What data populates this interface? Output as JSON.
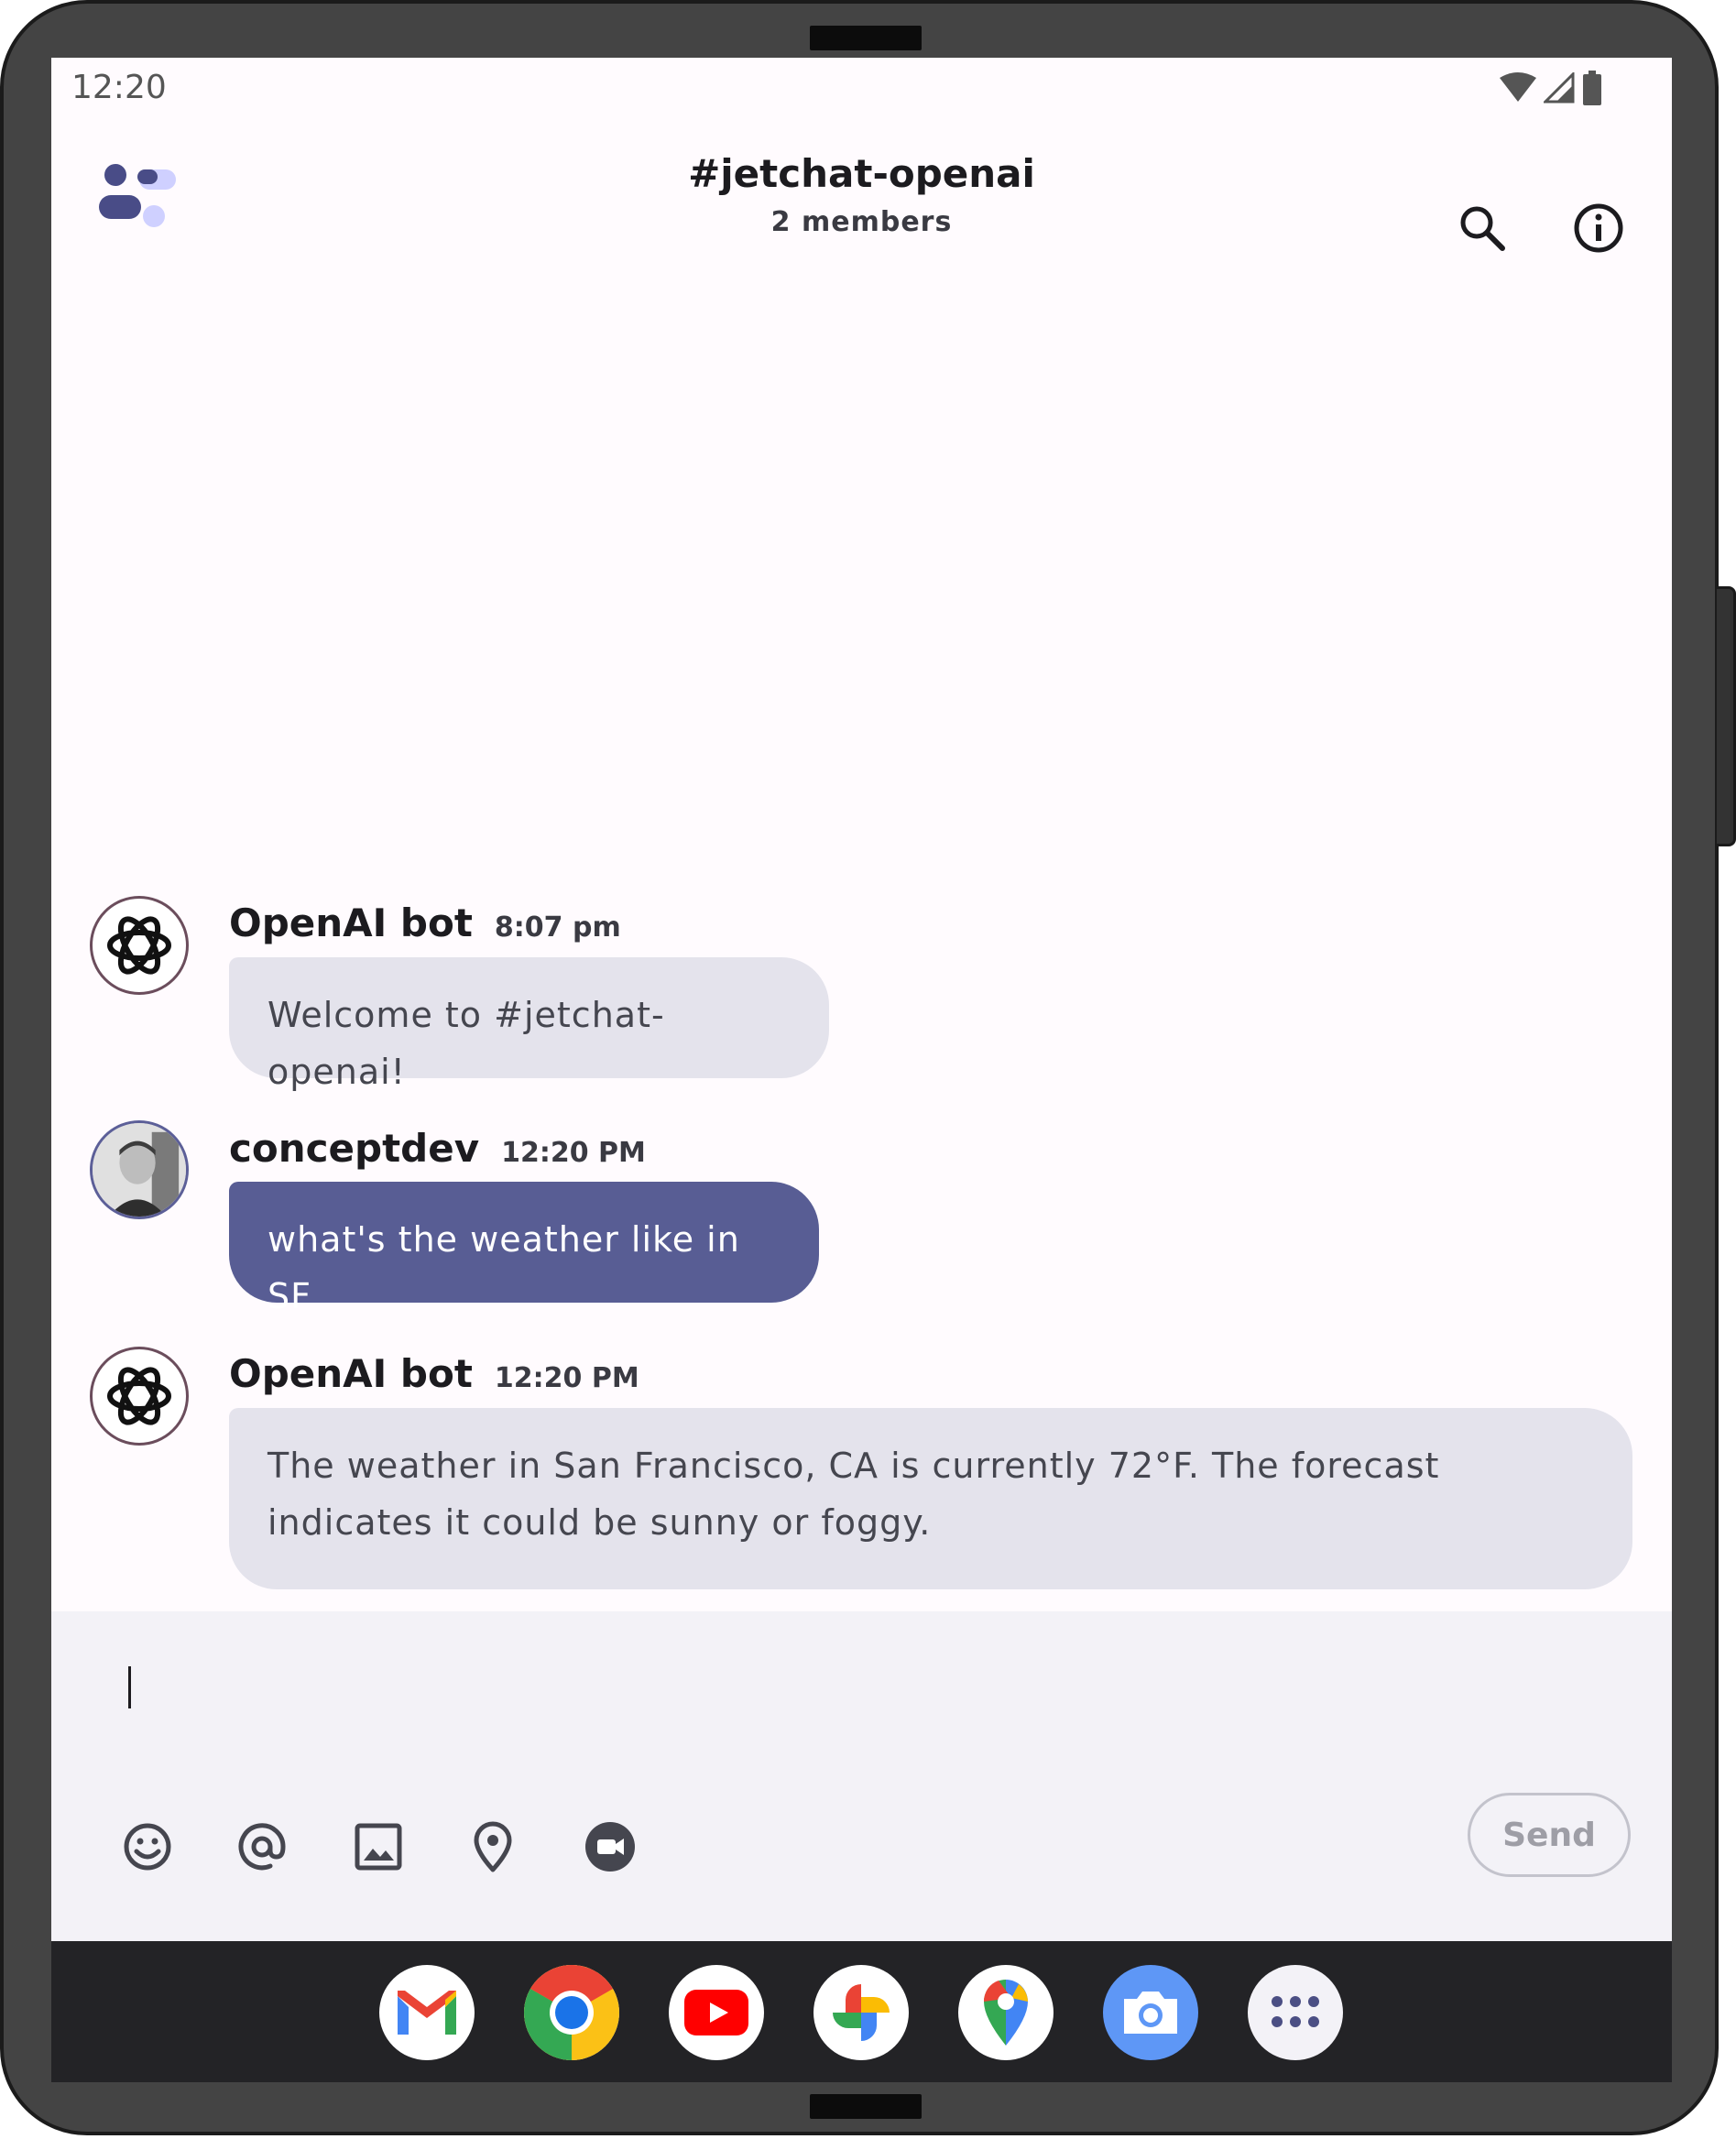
{
  "status_bar": {
    "time": "12:20"
  },
  "header": {
    "channel": "#jetchat-openai",
    "members": "2 members"
  },
  "messages": [
    {
      "author": "OpenAI bot",
      "time": "8:07 pm",
      "text": "Welcome to #jetchat-openai!"
    },
    {
      "author": "conceptdev",
      "time": "12:20 PM",
      "text": "what's the weather like in SF"
    },
    {
      "author": "OpenAI bot",
      "time": "12:20 PM",
      "text": "The weather in San Francisco, CA is currently 72°F. The forecast indicates it could be sunny or foggy."
    }
  ],
  "composer": {
    "value": "",
    "send_label": "Send"
  },
  "colors": {
    "accent": "#585d94",
    "bot_bubble": "#e4e3ec",
    "background": "#fffbfe",
    "composer_bg": "#f3f2f7",
    "dock_bg": "#232326"
  },
  "icons": {
    "header": [
      "app-logo-icon",
      "search-icon",
      "info-icon"
    ],
    "composer_tools": [
      "emoji-icon",
      "mention-icon",
      "image-icon",
      "location-icon",
      "video-call-icon"
    ],
    "dock": [
      "gmail-icon",
      "chrome-icon",
      "youtube-icon",
      "photos-icon",
      "maps-icon",
      "camera-icon",
      "app-drawer-icon"
    ]
  }
}
